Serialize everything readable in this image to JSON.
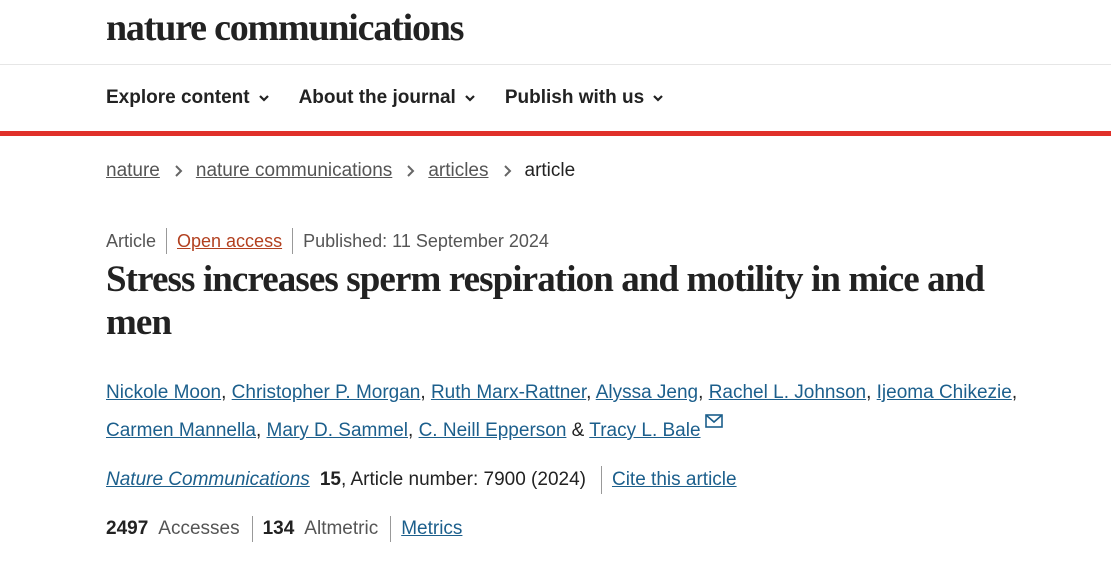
{
  "site": {
    "logo": "nature communications"
  },
  "nav": {
    "items": [
      {
        "label": "Explore content"
      },
      {
        "label": "About the journal"
      },
      {
        "label": "Publish with us"
      }
    ]
  },
  "breadcrumb": {
    "items": [
      "nature",
      "nature communications",
      "articles"
    ],
    "current": "article"
  },
  "article": {
    "type": "Article",
    "access": "Open access",
    "published": "Published: 11 September 2024",
    "title": "Stress increases sperm respiration and motility in mice and men",
    "authors": [
      "Nickole Moon",
      "Christopher P. Morgan",
      "Ruth Marx-Rattner",
      "Alyssa Jeng",
      "Rachel L. Johnson",
      "Ijeoma Chikezie",
      "Carmen Mannella",
      "Mary D. Sammel",
      "C. Neill Epperson",
      "Tracy L. Bale"
    ],
    "author_separator": ", ",
    "author_last_separator": " & ",
    "journal": "Nature Communications",
    "volume": "15",
    "article_number": ", Article number: 7900 (2024)",
    "cite_label": "Cite this article"
  },
  "metrics": {
    "accesses_count": "2497",
    "accesses_label": "Accesses",
    "altmetric_count": "134",
    "altmetric_label": "Altmetric",
    "metrics_link": "Metrics"
  },
  "colors": {
    "accent_red": "#e0302a",
    "link_blue": "#1c5f8c",
    "open_access": "#b2401f"
  },
  "icons": {
    "nav_chevron": "chevron-down-icon",
    "breadcrumb_sep": "chevron-right-icon",
    "corresponding_author": "mail-icon"
  }
}
